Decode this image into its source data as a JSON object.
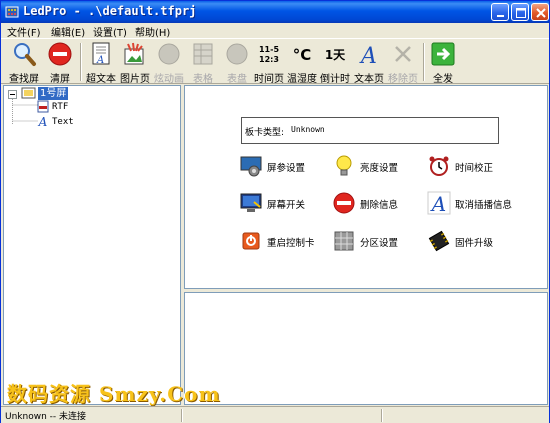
{
  "window": {
    "title": "LedPro - .\\default.tfprj"
  },
  "menu": [
    {
      "label": "文件(F)"
    },
    {
      "label": "编辑(E)"
    },
    {
      "label": "设置(T)"
    },
    {
      "label": "帮助(H)"
    }
  ],
  "toolbar": [
    {
      "label": "查找屏",
      "icon": "magnifier-icon",
      "enabled": true
    },
    {
      "label": "清屏",
      "icon": "clear-screen-icon",
      "enabled": true
    },
    {
      "label": "超文本",
      "icon": "hypertext-icon",
      "enabled": true
    },
    {
      "label": "图片页",
      "icon": "picture-page-icon",
      "enabled": true
    },
    {
      "label": "炫动画",
      "icon": "animation-icon",
      "enabled": false
    },
    {
      "label": "表格",
      "icon": "table-icon",
      "enabled": false
    },
    {
      "label": "表盘",
      "icon": "dial-icon",
      "enabled": false
    },
    {
      "label": "时间页",
      "icon": "time-page-icon",
      "enabled": true,
      "glyph": "11-5\n12:3"
    },
    {
      "label": "温湿度",
      "icon": "temperature-icon",
      "enabled": true,
      "glyph": "°C"
    },
    {
      "label": "倒计时",
      "icon": "countdown-icon",
      "enabled": true,
      "glyph": "1天"
    },
    {
      "label": "文本页",
      "icon": "text-page-icon",
      "enabled": true,
      "glyph": "A"
    },
    {
      "label": "移除页",
      "icon": "remove-page-icon",
      "enabled": false
    },
    {
      "label": "全发",
      "icon": "send-all-icon",
      "enabled": true
    }
  ],
  "tree": {
    "root": "1号屏",
    "children": [
      {
        "label": "RTF",
        "icon": "rtf-icon"
      },
      {
        "label": "Text",
        "icon": "text-icon"
      }
    ]
  },
  "card_type": {
    "label": "板卡类型:",
    "value": "Unknown"
  },
  "actions": [
    {
      "label": "屏参设置",
      "icon": "screen-params-icon"
    },
    {
      "label": "亮度设置",
      "icon": "brightness-bulb-icon"
    },
    {
      "label": "时间校正",
      "icon": "alarm-clock-icon"
    },
    {
      "label": "屏幕开关",
      "icon": "monitor-power-icon"
    },
    {
      "label": "删除信息",
      "icon": "delete-info-icon"
    },
    {
      "label": "取消插播信息",
      "icon": "cancel-insert-icon"
    },
    {
      "label": "重启控制卡",
      "icon": "restart-card-icon"
    },
    {
      "label": "分区设置",
      "icon": "partition-icon"
    },
    {
      "label": "固件升级",
      "icon": "firmware-chip-icon"
    }
  ],
  "status": {
    "text": "Unknown -- 未连接"
  },
  "watermark": "数码资源 Smzy.Com",
  "colors": {
    "titlebar": "#0055e5",
    "selection": "#316ac5",
    "window_bg": "#ece9d8"
  }
}
